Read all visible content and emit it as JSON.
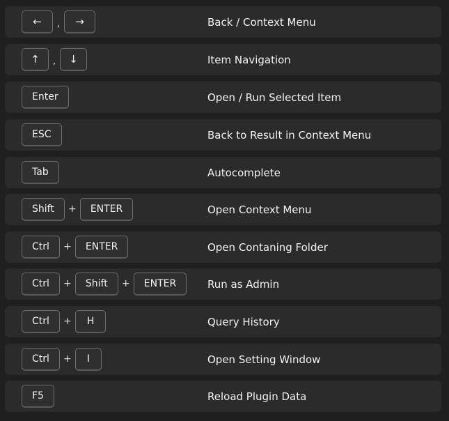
{
  "shortcuts": [
    {
      "keys": [
        "←",
        "→"
      ],
      "separator": ",",
      "description": "Back / Context Menu"
    },
    {
      "keys": [
        "↑",
        "↓"
      ],
      "separator": ",",
      "description": "Item Navigation"
    },
    {
      "keys": [
        "Enter"
      ],
      "separator": "",
      "description": "Open / Run Selected Item"
    },
    {
      "keys": [
        "ESC"
      ],
      "separator": "",
      "description": "Back to Result in Context Menu"
    },
    {
      "keys": [
        "Tab"
      ],
      "separator": "",
      "description": "Autocomplete"
    },
    {
      "keys": [
        "Shift",
        "ENTER"
      ],
      "separator": "+",
      "description": "Open Context Menu"
    },
    {
      "keys": [
        "Ctrl",
        "ENTER"
      ],
      "separator": "+",
      "description": "Open Contaning Folder"
    },
    {
      "keys": [
        "Ctrl",
        "Shift",
        "ENTER"
      ],
      "separator": "+",
      "description": "Run as Admin"
    },
    {
      "keys": [
        "Ctrl",
        "H"
      ],
      "separator": "+",
      "description": "Query History"
    },
    {
      "keys": [
        "Ctrl",
        "I"
      ],
      "separator": "+",
      "description": "Open Setting Window"
    },
    {
      "keys": [
        "F5"
      ],
      "separator": "",
      "description": "Reload Plugin Data"
    }
  ]
}
